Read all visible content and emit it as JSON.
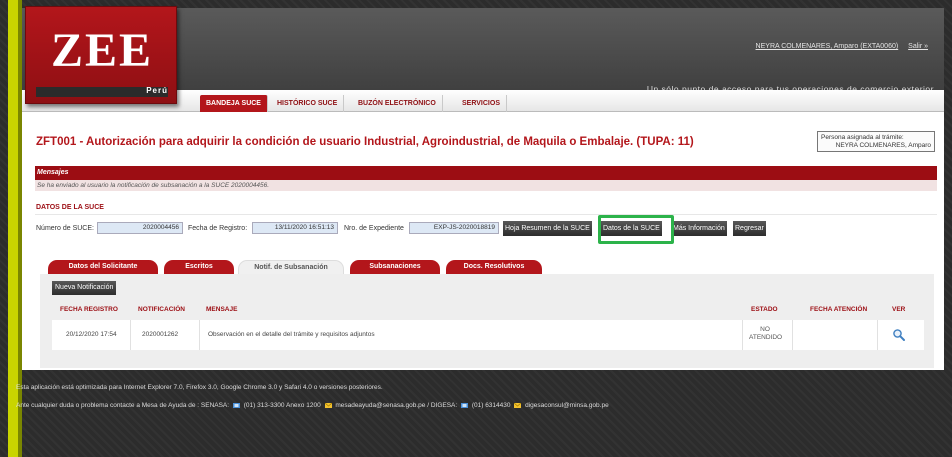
{
  "logo": {
    "brand": "ZEE",
    "country": "Perú"
  },
  "header": {
    "user": "NEYRA COLMENARES, Amparo  (EXTA0060)",
    "logout": "Salir »",
    "tagline": "Un sólo punto de acceso para tus operaciones de comercio exterior"
  },
  "nav": {
    "tabs": [
      {
        "label": "BANDEJA SUCE",
        "active": true
      },
      {
        "label": "HISTÓRICO SUCE",
        "active": false
      },
      {
        "label": "BUZÓN ELECTRÓNICO",
        "active": false
      },
      {
        "label": "SERVICIOS",
        "active": false
      }
    ]
  },
  "page": {
    "title": "ZFT001 - Autorización para adquirir la condición de usuario Industrial, Agroindustrial, de Maquila o Embalaje. (TUPA: 11)",
    "assigned_label": "Persona asignada al trámite:",
    "assigned_value": "NEYRA COLMENARES, Amparo"
  },
  "messages": {
    "header": "Mensajes",
    "text": "Se ha enviado al usuario la notificación de subsanación a la SUCE 2020004456."
  },
  "suce": {
    "section_label": "DATOS DE LA SUCE",
    "number_label": "Número de SUCE:",
    "number_value": "2020004456",
    "date_label": "Fecha de Registro:",
    "date_value": "13/11/2020 16:51:13",
    "expediente_label": "Nro. de Expediente",
    "expediente_value": "EXP-JS-2020018819",
    "buttons": {
      "resumen": "Hoja Resumen de la SUCE",
      "datos": "Datos de la SUCE",
      "mas_info": "Más Información",
      "regresar": "Regresar"
    }
  },
  "subtabs": [
    {
      "label": "Datos del Solicitante",
      "active": false
    },
    {
      "label": "Escritos",
      "active": false
    },
    {
      "label": "Notif. de Subsanación",
      "active": true
    },
    {
      "label": "Subsanaciones",
      "active": false
    },
    {
      "label": "Docs. Resolutivos",
      "active": false
    }
  ],
  "notifications": {
    "new_button": "Nueva Notificación",
    "columns": [
      "FECHA REGISTRO",
      "NOTIFICACIÓN",
      "MENSAJE",
      "ESTADO",
      "FECHA ATENCIÓN",
      "VER"
    ],
    "rows": [
      {
        "fecha_registro": "20/12/2020 17:54",
        "notificacion": "2020001262",
        "mensaje": "Observación en el detalle del trámite y requisitos adjuntos",
        "estado_line1": "NO",
        "estado_line2": "ATENDIDO",
        "fecha_atencion": "",
        "ver_icon": "search-icon"
      }
    ]
  },
  "footer": {
    "line1": "Esta aplicación está optimizada para Internet Explorer 7.0, Firefox 3.0, Google Chrome 3.0 y Safari 4.0 o versiones posteriores.",
    "line2_prefix": "Ante cualquier duda o problema contacte a Mesa de Ayuda de :  SENASA:",
    "senasa_phone": "(01) 313-3300 Anexo 1200",
    "senasa_email": "mesadeayuda@senasa.gob.pe",
    "digesa_label": "/  DIGESA:",
    "digesa_phone": "(01) 6314430",
    "digesa_email": "digesaconsul@minsa.gob.pe"
  },
  "colors": {
    "brand_red": "#b3161b",
    "accent_green": "#2cb34a",
    "header_gray": "#404040",
    "lime": "#c9d400"
  }
}
